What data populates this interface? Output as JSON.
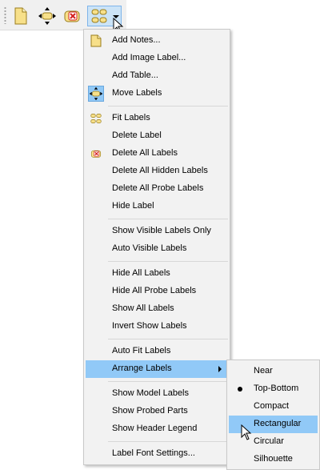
{
  "toolbar": {
    "buttons": [
      {
        "icon": "note-icon",
        "pressed": false
      },
      {
        "icon": "move-labels-icon",
        "pressed": false
      },
      {
        "icon": "delete-labels-icon",
        "pressed": false
      },
      {
        "icon": "fit-labels-icon",
        "pressed": true
      }
    ]
  },
  "menu": {
    "items": [
      {
        "label": "Add Notes...",
        "icon": "note-icon"
      },
      {
        "label": "Add Image Label...",
        "icon": ""
      },
      {
        "label": "Add Table...",
        "icon": ""
      },
      {
        "label": "Move Labels",
        "icon": "move-labels-icon",
        "checked": true
      },
      {
        "label": "Fit Labels",
        "icon": "fit-labels-icon"
      },
      {
        "label": "Delete Label",
        "icon": ""
      },
      {
        "label": "Delete All Labels",
        "icon": "delete-labels-icon"
      },
      {
        "label": "Delete All Hidden Labels",
        "icon": ""
      },
      {
        "label": "Delete All Probe Labels",
        "icon": ""
      },
      {
        "label": "Hide Label",
        "icon": ""
      },
      {
        "label": "Show Visible Labels Only",
        "icon": ""
      },
      {
        "label": "Auto Visible Labels",
        "icon": ""
      },
      {
        "label": "Hide All Labels",
        "icon": ""
      },
      {
        "label": "Hide All Probe Labels",
        "icon": ""
      },
      {
        "label": "Show All Labels",
        "icon": ""
      },
      {
        "label": "Invert Show Labels",
        "icon": ""
      },
      {
        "label": "Auto Fit Labels",
        "icon": ""
      },
      {
        "label": "Arrange Labels",
        "icon": "",
        "submenu": true,
        "highlighted": true
      },
      {
        "label": "Show Model Labels",
        "icon": ""
      },
      {
        "label": "Show Probed Parts",
        "icon": ""
      },
      {
        "label": "Show Header Legend",
        "icon": ""
      },
      {
        "label": "Label Font Settings...",
        "icon": ""
      }
    ]
  },
  "submenu": {
    "items": [
      {
        "label": "Near",
        "selected": false
      },
      {
        "label": "Top-Bottom",
        "selected": true
      },
      {
        "label": "Compact",
        "selected": false
      },
      {
        "label": "Rectangular",
        "selected": false,
        "highlighted": true
      },
      {
        "label": "Circular",
        "selected": false
      },
      {
        "label": "Silhouette",
        "selected": false
      }
    ]
  },
  "colors": {
    "highlight": "#91c9f7",
    "menu_bg": "#f2f2f2",
    "note_yellow": "#f7e08a",
    "delete_red": "#d42020"
  }
}
